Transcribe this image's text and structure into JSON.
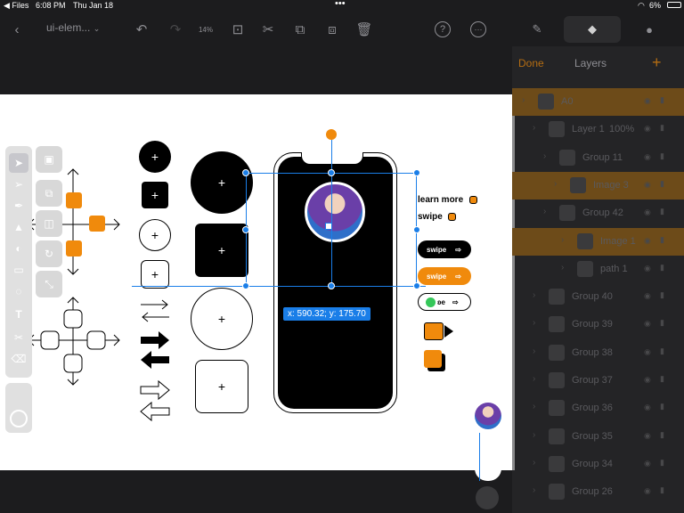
{
  "status_bar": {
    "back_app": "◀ Files",
    "time": "6:08 PM",
    "date": "Thu Jan 18",
    "battery": "6%"
  },
  "toolbar": {
    "document_title": "ui-elem...",
    "undo_label": "14%"
  },
  "layers_panel": {
    "done_label": "Done",
    "title": "Layers",
    "add_label": "+",
    "rows": [
      {
        "name": "A0",
        "highlighted": true
      },
      {
        "name": "Layer 1",
        "extra": "100%",
        "highlighted": false
      },
      {
        "name": "Group 11",
        "highlighted": false
      },
      {
        "name": "Image 3",
        "highlighted": true
      },
      {
        "name": "Group 42",
        "highlighted": false
      },
      {
        "name": "Image 1",
        "highlighted": true
      },
      {
        "name": "path 1",
        "highlighted": false
      },
      {
        "name": "Group 40",
        "highlighted": false
      },
      {
        "name": "Group 39",
        "highlighted": false
      },
      {
        "name": "Group 38",
        "highlighted": false
      },
      {
        "name": "Group 37",
        "highlighted": false
      },
      {
        "name": "Group 36",
        "highlighted": false
      },
      {
        "name": "Group 35",
        "highlighted": false
      },
      {
        "name": "Group 34",
        "highlighted": false
      },
      {
        "name": "Group 26",
        "highlighted": false
      }
    ]
  },
  "canvas": {
    "learn_more_label": "learn more",
    "swipe_label": "swipe",
    "pill_swipe_1": "swipe",
    "pill_swipe_2": "swipe",
    "pill_toggle": "ʚe",
    "coordinates": "x: 590.32; y: 175.70"
  },
  "colors": {
    "accent": "#f08a0c",
    "selection": "#1a7ee8",
    "toggle_green": "#35c759"
  }
}
